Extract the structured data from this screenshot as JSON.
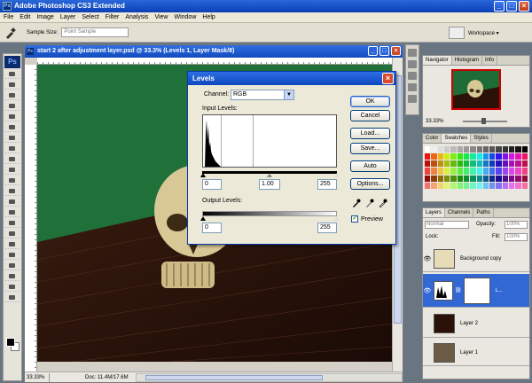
{
  "app": {
    "title": "Adobe Photoshop CS3 Extended",
    "icon": "Ps"
  },
  "menu": [
    "File",
    "Edit",
    "Image",
    "Layer",
    "Select",
    "Filter",
    "Analysis",
    "View",
    "Window",
    "Help"
  ],
  "options_bar": {
    "sample_size_label": "Sample Size:",
    "sample_size_value": "Point Sample",
    "workspace_label": "Workspace ▾"
  },
  "document": {
    "title": "start 2 after adjustment layer.psd @ 33.3% (Levels 1, Layer Mask/8)",
    "zoom": "33.33%",
    "doc_info": "Doc: 11.4M/17.6M"
  },
  "levels": {
    "title": "Levels",
    "channel_label": "Channel:",
    "channel_value": "RGB",
    "input_label": "Input Levels:",
    "input_values": [
      "0",
      "1.00",
      "255"
    ],
    "output_label": "Output Levels:",
    "output_values": [
      "0",
      "255"
    ],
    "buttons": {
      "ok": "OK",
      "cancel": "Cancel",
      "load": "Load...",
      "save": "Save...",
      "auto": "Auto",
      "options": "Options..."
    },
    "preview_label": "Preview",
    "preview_checked": true
  },
  "panels": {
    "navigator_tabs": [
      "Navigator",
      "Histogram",
      "Info"
    ],
    "navigator_zoom": "33.33%",
    "color_tabs": [
      "Color",
      "Swatches",
      "Styles"
    ],
    "layers_tabs": [
      "Layers",
      "Channels",
      "Paths"
    ],
    "blend_mode": "Normal",
    "opacity_label": "Opacity:",
    "opacity_value": "100%",
    "lock_label": "Lock:",
    "fill_label": "Fill:",
    "fill_value": "100%",
    "layers": [
      "Background copy",
      "L...",
      "Layer 2",
      "Layer 1"
    ]
  },
  "icons": [
    "ps-app-icon",
    "eyedropper-icon",
    "minimize-icon",
    "maximize-icon",
    "close-icon",
    "eye-icon",
    "link-icon"
  ]
}
